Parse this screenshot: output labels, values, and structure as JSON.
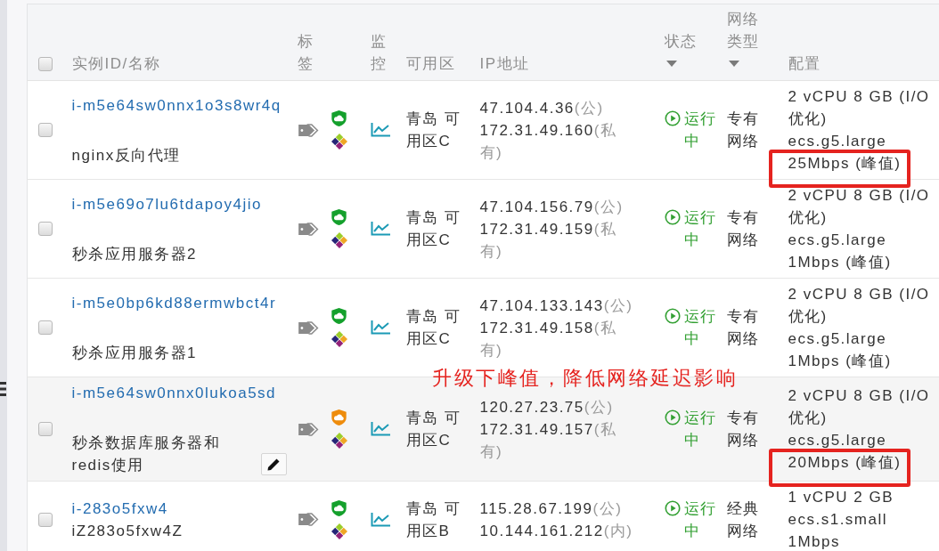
{
  "table": {
    "select_all_checked": false,
    "columns": [
      {
        "label": "实例ID/名称",
        "filterable": false
      },
      {
        "label": "标签",
        "filterable": false
      },
      {
        "label": "监控",
        "filterable": false
      },
      {
        "label": "可用区",
        "filterable": false
      },
      {
        "label": "IP地址",
        "filterable": false
      },
      {
        "label": "状态",
        "filterable": true
      },
      {
        "label": "网络类型",
        "filterable": true
      },
      {
        "label": "配置",
        "filterable": false
      }
    ],
    "rows": [
      {
        "kind": "vpc",
        "checked": false,
        "hovered": false,
        "highlighted": true,
        "id": "i-m5e64sw0nnx1o3s8wr4q",
        "name": "nginx反向代理",
        "security": {
          "color": "#14a02c"
        },
        "zone": "青岛 可用区C",
        "ips": [
          {
            "address": "47.104.4.36",
            "note": "(公)"
          },
          {
            "address": "172.31.49.160",
            "note": "(私有)"
          }
        ],
        "status": {
          "kind": "running",
          "label": "运行中"
        },
        "network": "专有网络",
        "config": {
          "spec": "2 vCPU 8 GB (I/O 优化)",
          "instance_type": "ecs.g5.large",
          "bandwidth": "25Mbps (峰值)"
        }
      },
      {
        "kind": "vpc",
        "checked": false,
        "hovered": false,
        "highlighted": false,
        "id": "i-m5e69o7lu6tdapoy4jio",
        "name": "秒杀应用服务器2",
        "security": {
          "color": "#14a02c"
        },
        "zone": "青岛 可用区C",
        "ips": [
          {
            "address": "47.104.156.79",
            "note": "(公)"
          },
          {
            "address": "172.31.49.159",
            "note": "(私有)"
          }
        ],
        "status": {
          "kind": "running",
          "label": "运行中"
        },
        "network": "专有网络",
        "config": {
          "spec": "2 vCPU 8 GB (I/O 优化)",
          "instance_type": "ecs.g5.large",
          "bandwidth": "1Mbps (峰值)"
        }
      },
      {
        "kind": "vpc",
        "checked": false,
        "hovered": false,
        "highlighted": false,
        "id": "i-m5e0bp6kd88ermwbct4r",
        "name": "秒杀应用服务器1",
        "security": {
          "color": "#14a02c"
        },
        "zone": "青岛 可用区C",
        "ips": [
          {
            "address": "47.104.133.143",
            "note": "(公)"
          },
          {
            "address": "172.31.49.158",
            "note": "(私有)"
          }
        ],
        "status": {
          "kind": "running",
          "label": "运行中"
        },
        "network": "专有网络",
        "config": {
          "spec": "2 vCPU 8 GB (I/O 优化)",
          "instance_type": "ecs.g5.large",
          "bandwidth": "1Mbps (峰值)"
        }
      },
      {
        "kind": "vpc",
        "checked": false,
        "hovered": true,
        "highlighted": true,
        "id": "i-m5e64sw0nnx0lukoa5sd",
        "name": "秒杀数据库服务器和redis使用",
        "security": {
          "color": "#ee8c0c"
        },
        "zone": "青岛 可用区C",
        "ips": [
          {
            "address": "120.27.23.75",
            "note": "(公)"
          },
          {
            "address": "172.31.49.157",
            "note": "(私有)"
          }
        ],
        "status": {
          "kind": "running",
          "label": "运行中"
        },
        "network": "专有网络",
        "config": {
          "spec": "2 vCPU 8 GB (I/O 优化)",
          "instance_type": "ecs.g5.large",
          "bandwidth": "20Mbps (峰值)"
        }
      },
      {
        "kind": "classic",
        "checked": false,
        "hovered": false,
        "highlighted": false,
        "id": "i-283o5fxw4",
        "name": "iZ283o5fxw4Z",
        "security": {
          "color": "#14a02c"
        },
        "zone": "青岛 可用区B",
        "ips": [
          {
            "address": "115.28.67.199",
            "note": "(公)"
          },
          {
            "address": "10.144.161.212",
            "note": "(内)"
          }
        ],
        "status": {
          "kind": "running",
          "label": "运行中"
        },
        "network": "经典网络",
        "config": {
          "spec": "1 vCPU 2 GB",
          "instance_type": "ecs.s1.small",
          "bandwidth": "1Mbps"
        }
      }
    ]
  },
  "annotation": {
    "text": "升级下峰值，降低网络延迟影响"
  }
}
